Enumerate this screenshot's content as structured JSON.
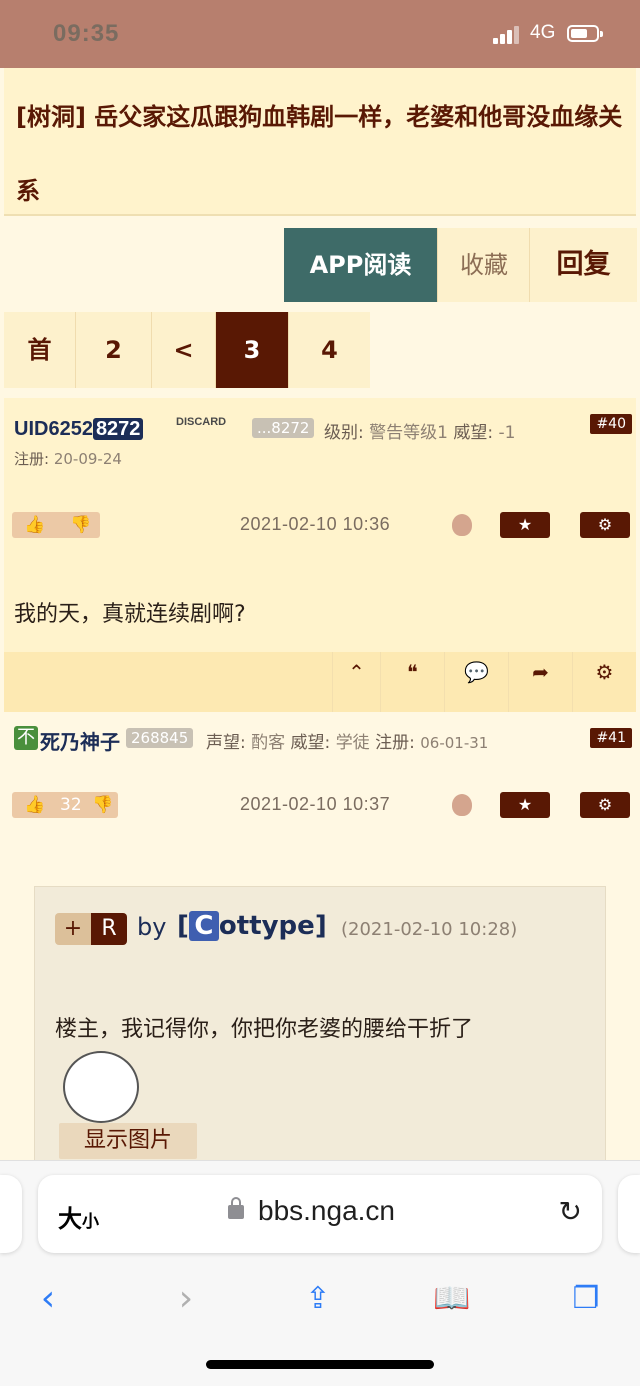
{
  "status": {
    "time": "09:35",
    "network": "4G"
  },
  "title": "[树洞] 岳父家这瓜跟狗血韩剧一样，老婆和他哥没血缘关系",
  "actions": {
    "app": "APP阅读",
    "fav": "收藏",
    "reply": "回复"
  },
  "pager": [
    "首",
    "2",
    "<",
    "3",
    "4"
  ],
  "post40": {
    "uid_prefix": "UID6252",
    "uid_highlight": "8272",
    "discard": "DISCARD",
    "tag": "...8272",
    "level_label": "级别:",
    "level": "警告等级1",
    "prestige_label": "威望:",
    "prestige": "-1",
    "reg_label": "注册:",
    "reg": "20-09-24",
    "floor": "#40",
    "time": "2021-02-10 10:36",
    "content": "我的天，真就连续剧啊?"
  },
  "post41": {
    "badge": "不",
    "name": "死乃神子",
    "tag": "268845",
    "rep_label": "声望:",
    "rep": "酌客",
    "prestige_label": "威望:",
    "prestige": "学徒",
    "reg_label": "注册:",
    "reg": "06-01-31",
    "floor": "#41",
    "likes": "32",
    "time": "2021-02-10 10:37",
    "quote": {
      "plus": "+",
      "r": "R",
      "by": "by",
      "c": "C",
      "name": "ottype",
      "bracket_l": "[",
      "bracket_r": "]",
      "time": "(2021-02-10 10:28)",
      "text": "楼主，我记得你，你把你老婆的腰给干折了",
      "show_img": "显示图片"
    }
  },
  "browser": {
    "aa_big": "大",
    "aa_small": "小",
    "url": "bbs.nga.cn"
  }
}
